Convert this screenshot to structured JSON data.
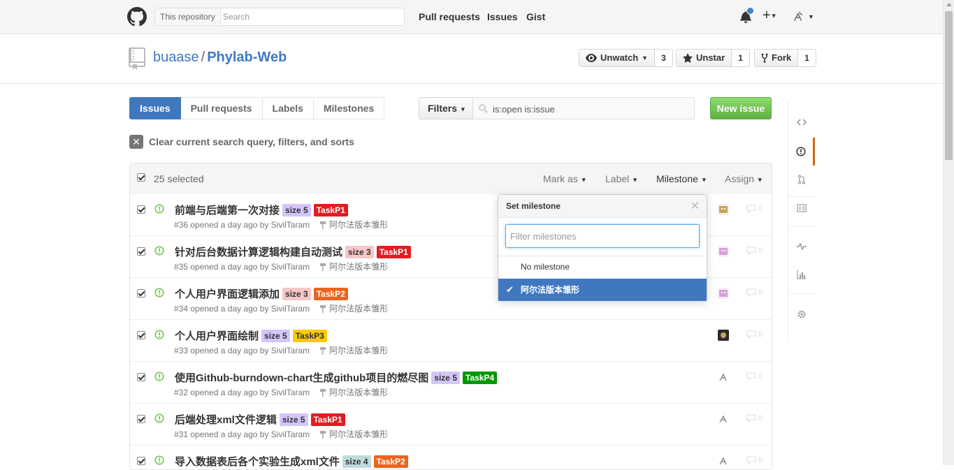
{
  "header": {
    "search_scope": "This repository",
    "search_placeholder": "Search",
    "nav": [
      "Pull requests",
      "Issues",
      "Gist"
    ]
  },
  "repo": {
    "owner": "buaase",
    "separator": "/",
    "name": "Phylab-Web",
    "watch_label": "Unwatch",
    "watch_count": "3",
    "star_label": "Unstar",
    "star_count": "1",
    "fork_label": "Fork",
    "fork_count": "1"
  },
  "subnav": {
    "items": [
      "Issues",
      "Pull requests",
      "Labels",
      "Milestones"
    ],
    "selected": "Issues",
    "filters_label": "Filters",
    "filter_value": "is:open is:issue",
    "new_issue_label": "New issue"
  },
  "clear_search_label": "Clear current search query, filters, and sorts",
  "issues_header": {
    "selected_count": "25 selected",
    "menus": [
      "Mark as",
      "Label",
      "Milestone",
      "Assign"
    ]
  },
  "issues": [
    {
      "title": "前端与后端第一次对接",
      "labels": [
        {
          "text": "size 5",
          "bg": "#d4c5f9",
          "fg": "#333"
        },
        {
          "text": "TaskP1",
          "bg": "#e11d21",
          "fg": "#fff"
        }
      ],
      "meta": "#36 opened a day ago by SivilTaram",
      "milestone": "阿尔法版本雏形"
    },
    {
      "title": "针对后台数据计算逻辑构建自动测试",
      "labels": [
        {
          "text": "size 3",
          "bg": "#f7c6c7",
          "fg": "#333"
        },
        {
          "text": "TaskP1",
          "bg": "#e11d21",
          "fg": "#fff"
        }
      ],
      "meta": "#35 opened a day ago by SivilTaram",
      "milestone": "阿尔法版本雏形"
    },
    {
      "title": "个人用户界面逻辑添加",
      "labels": [
        {
          "text": "size 3",
          "bg": "#f7c6c7",
          "fg": "#333"
        },
        {
          "text": "TaskP2",
          "bg": "#eb6420",
          "fg": "#fff"
        }
      ],
      "meta": "#34 opened a day ago by SivilTaram",
      "milestone": "阿尔法版本雏形"
    },
    {
      "title": "个人用户界面绘制",
      "labels": [
        {
          "text": "size 5",
          "bg": "#d4c5f9",
          "fg": "#333"
        },
        {
          "text": "TaskP3",
          "bg": "#fbca04",
          "fg": "#333"
        }
      ],
      "meta": "#33 opened a day ago by SivilTaram",
      "milestone": "阿尔法版本雏形"
    },
    {
      "title": "使用Github-burndown-chart生成github项目的燃尽图",
      "labels": [
        {
          "text": "size 5",
          "bg": "#d4c5f9",
          "fg": "#333"
        },
        {
          "text": "TaskP4",
          "bg": "#009800",
          "fg": "#fff"
        }
      ],
      "meta": "#32 opened a day ago by SivilTaram",
      "milestone": "阿尔法版本雏形"
    },
    {
      "title": "后端处理xml文件逻辑",
      "labels": [
        {
          "text": "size 5",
          "bg": "#d4c5f9",
          "fg": "#333"
        },
        {
          "text": "TaskP1",
          "bg": "#e11d21",
          "fg": "#fff"
        }
      ],
      "meta": "#31 opened a day ago by SivilTaram",
      "milestone": "阿尔法版本雏形"
    },
    {
      "title": "导入数据表后各个实验生成xml文件",
      "labels": [
        {
          "text": "size 4",
          "bg": "#bfdadc",
          "fg": "#333"
        },
        {
          "text": "TaskP2",
          "bg": "#eb6420",
          "fg": "#fff"
        }
      ],
      "meta": "",
      "milestone": ""
    }
  ],
  "comment_count": "0",
  "milestone_dropdown": {
    "title": "Set milestone",
    "filter_placeholder": "Filter milestones",
    "options": [
      "No milestone",
      "阿尔法版本雏形"
    ],
    "selected": "阿尔法版本雏形"
  },
  "colors": {
    "accent": "#4078c0",
    "open_issue": "#6cc644",
    "new_issue_green": "#60b044",
    "rail_active": "#d26911"
  }
}
